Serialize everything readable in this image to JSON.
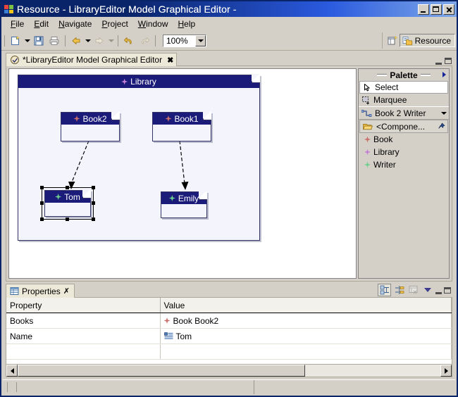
{
  "window": {
    "title": "Resource - LibraryEditor Model Graphical Editor -",
    "icon": "eclipse-icon",
    "buttons": {
      "minimize": "minimize-icon",
      "maximize": "maximize-icon",
      "close": "close-icon"
    }
  },
  "menubar": {
    "items": [
      {
        "label": "File",
        "mnemonic": "F"
      },
      {
        "label": "Edit",
        "mnemonic": "E"
      },
      {
        "label": "Navigate",
        "mnemonic": "N"
      },
      {
        "label": "Project",
        "mnemonic": "P"
      },
      {
        "label": "Window",
        "mnemonic": "W"
      },
      {
        "label": "Help",
        "mnemonic": "H"
      }
    ]
  },
  "toolbar": {
    "new_label": "new-wizard-icon",
    "save_label": "save-icon",
    "print_label": "print-icon",
    "back_label": "back-icon",
    "forward_label": "forward-icon",
    "undo_label": "undo-icon",
    "redo_label": "redo-icon",
    "zoom": {
      "value": "100%",
      "dropdown": "zoom-dropdown-arrow"
    }
  },
  "perspective": {
    "open_button": "open-perspective-icon",
    "active": "Resource",
    "active_icon": "resource-perspective-icon"
  },
  "editor": {
    "tab": {
      "label": "*LibraryEditor Model Graphical Editor",
      "close": "✖",
      "icon": "editor-icon"
    },
    "minimize": "minimize-icon",
    "maximize": "maximize-icon"
  },
  "diagram": {
    "container": {
      "label": "Library",
      "icon_color": "#c57fd6"
    },
    "nodes": [
      {
        "id": "book2",
        "label": "Book2",
        "icon_color": "#c9706a",
        "selected": false
      },
      {
        "id": "book1",
        "label": "Book1",
        "icon_color": "#c9706a",
        "selected": false
      },
      {
        "id": "tom",
        "label": "Tom",
        "icon_color": "#6fcf8f",
        "selected": true
      },
      {
        "id": "emily",
        "label": "Emily",
        "icon_color": "#6fcf8f",
        "selected": false
      }
    ],
    "connections": [
      {
        "from": "book2",
        "to": "tom",
        "style": "dashed",
        "arrow": "filled"
      },
      {
        "from": "book1",
        "to": "emily",
        "style": "dashed",
        "arrow": "filled"
      }
    ],
    "colors": {
      "title_bar": "#1b1b7a",
      "container_fill": "#f4f4fd",
      "node_fill": "#ffffff",
      "border": "#333366"
    }
  },
  "palette": {
    "header": "Palette",
    "collapse": "collapse-palette-arrow",
    "tools": [
      {
        "label": "Select",
        "icon": "select-arrow-icon",
        "selected": true
      },
      {
        "label": "Marquee",
        "icon": "marquee-icon",
        "selected": false
      }
    ],
    "connection_group": {
      "label": "Book 2 Writer",
      "icon": "connection-icon",
      "dropdown": "drawer-dropdown-arrow"
    },
    "drawer": {
      "label": "<Compone...",
      "icon": "open-folder-icon",
      "pin": "pin-icon"
    },
    "creation_tools": [
      {
        "label": "Book",
        "icon": "book-diamond-icon",
        "color": "#c9706a"
      },
      {
        "label": "Library",
        "icon": "library-diamond-icon",
        "color": "#c57fd6"
      },
      {
        "label": "Writer",
        "icon": "writer-diamond-icon",
        "color": "#6fcf8f"
      }
    ]
  },
  "properties": {
    "tab": {
      "label": "Properties",
      "icon": "properties-icon",
      "close": "✗"
    },
    "tools": [
      {
        "name": "show-categories-icon",
        "pressed": true
      },
      {
        "name": "restore-defaults-icon",
        "pressed": false
      },
      {
        "name": "filter-icon",
        "pressed": false,
        "disabled": true
      },
      {
        "name": "view-menu-arrow",
        "pressed": false
      }
    ],
    "minimize": "minimize-icon",
    "maximize": "maximize-icon",
    "columns": [
      "Property",
      "Value"
    ],
    "rows": [
      {
        "property": "Books",
        "value": "Book Book2",
        "value_icon": "book-diamond-icon",
        "value_icon_color": "#c9706a"
      },
      {
        "property": "Name",
        "value": "Tom",
        "value_icon": "text-property-icon",
        "value_icon_color": "#3a6ea5"
      },
      {
        "property": "",
        "value": "",
        "value_icon": "",
        "value_icon_color": ""
      }
    ],
    "scrollbar": {
      "left": "scroll-left-arrow",
      "right": "scroll-right-arrow"
    }
  },
  "statusbar": {
    "left": "",
    "right": ""
  }
}
